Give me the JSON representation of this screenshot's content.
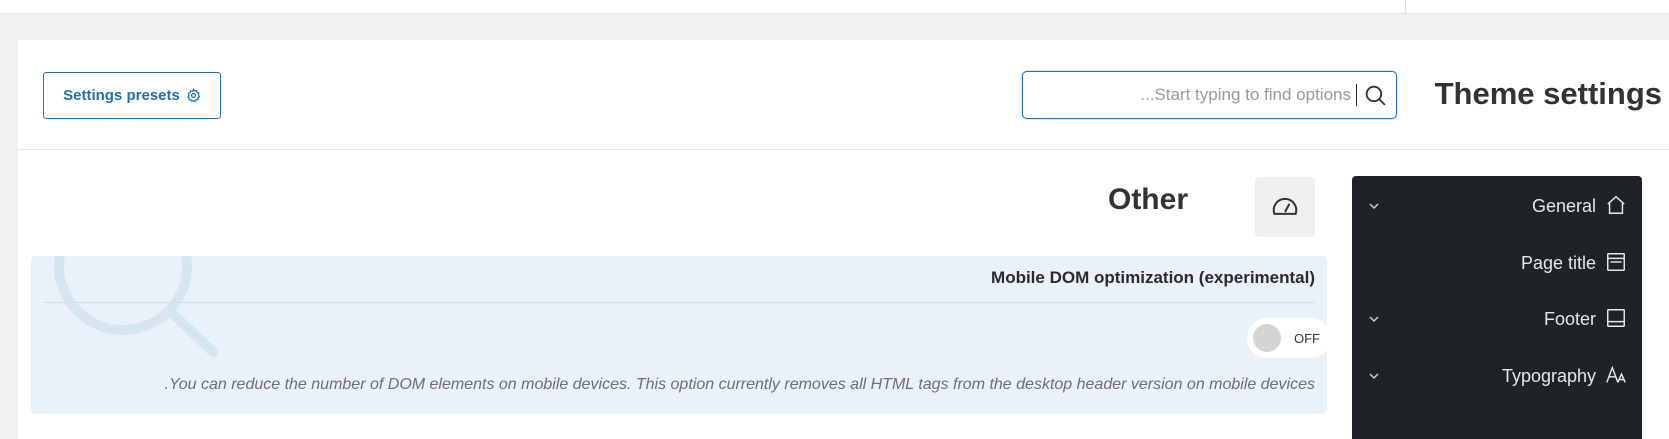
{
  "header": {
    "presets_button_label": "Settings presets",
    "search_placeholder": "...Start typing to find options",
    "page_title": "Theme settings"
  },
  "section": {
    "title": "Other",
    "icon": "speedometer-icon"
  },
  "option": {
    "title": "Mobile DOM optimization (experimental)",
    "toggle_state": "OFF",
    "description": ".You can reduce the number of DOM elements on mobile devices. This option currently removes all HTML tags from the desktop header version on mobile devices"
  },
  "sidebar": {
    "items": [
      {
        "label": "General",
        "icon": "home-icon",
        "expandable": true
      },
      {
        "label": "Page title",
        "icon": "page-title-icon",
        "expandable": false
      },
      {
        "label": "Footer",
        "icon": "footer-icon",
        "expandable": true
      },
      {
        "label": "Typography",
        "icon": "typography-icon",
        "expandable": true
      }
    ]
  },
  "colors": {
    "accent": "#2271b1",
    "sidebar_bg": "#1f2327",
    "option_bg": "#eaf2f9",
    "page_bg": "#f1f1f1"
  }
}
